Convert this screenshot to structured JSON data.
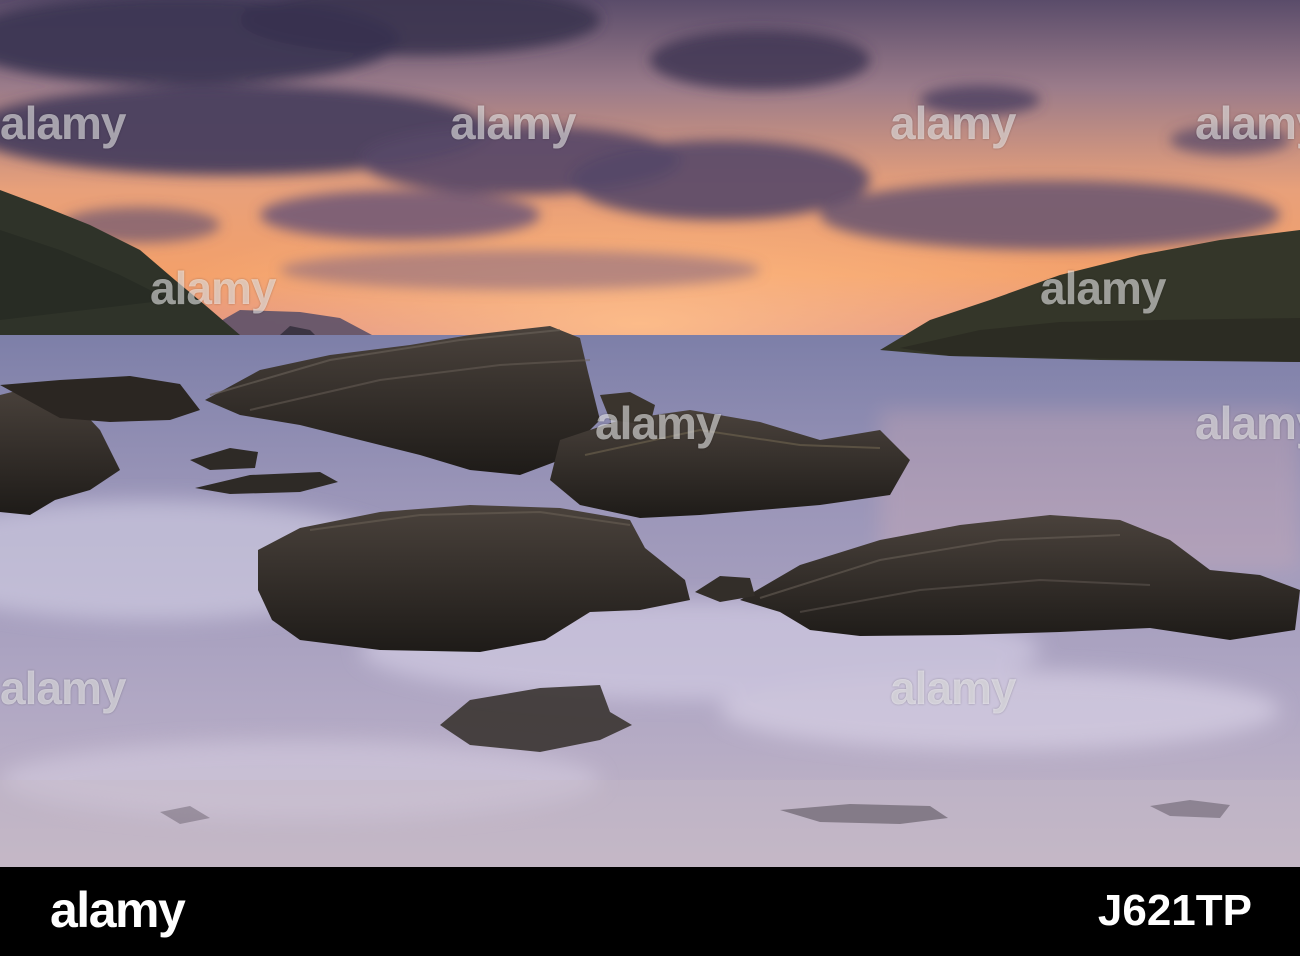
{
  "watermark": {
    "text": "alamy",
    "color": "#ffffff"
  },
  "footer": {
    "logo_text": "alamy",
    "image_id": "J621TP",
    "background": "#000000",
    "text_color": "#ffffff"
  },
  "scene": {
    "subject": "rocky-cove-sunset",
    "sky_colors": [
      "#3a3350",
      "#7a5f82",
      "#e58a55",
      "#f7b27a"
    ],
    "sea_color": "#8b86b0",
    "rock_color": "#2a2622"
  }
}
